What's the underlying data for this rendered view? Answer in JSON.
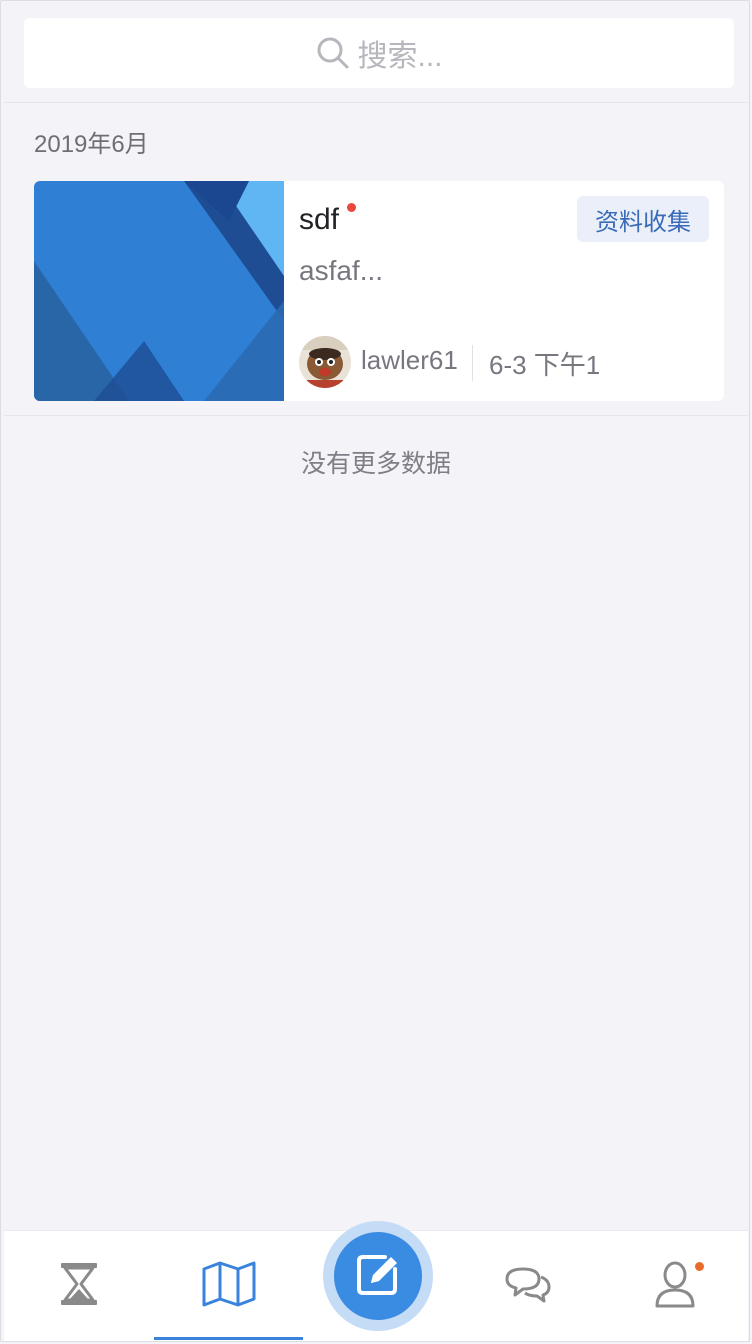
{
  "search": {
    "placeholder": "搜索...",
    "icon": "search-icon"
  },
  "feed": {
    "month_label": "2019年6月",
    "items": [
      {
        "title": "sdf",
        "unread": true,
        "tag": "资料收集",
        "summary": "asfaf...",
        "author": "lawler61",
        "time": "6-3 下午1",
        "thumbnail_colors": [
          "#2f7fd5",
          "#5fb6f2",
          "#1e4d93"
        ]
      }
    ],
    "end_text": "没有更多数据"
  },
  "tabbar": {
    "tabs": [
      {
        "icon": "hourglass-icon",
        "active": false
      },
      {
        "icon": "map-icon",
        "active": true
      },
      {
        "icon": "compose-icon",
        "active": false
      },
      {
        "icon": "chat-icon",
        "active": false
      },
      {
        "icon": "user-icon",
        "active": false,
        "badge_dot": true
      }
    ]
  },
  "colors": {
    "accent": "#3a83dc",
    "background": "#f3f3f8",
    "unread_dot": "#e8463f",
    "badge_dot": "#ec6a2c",
    "tag_text": "#3a6bb8",
    "tag_bg": "#eaeff9",
    "tab_inactive": "#8a8a8a"
  }
}
